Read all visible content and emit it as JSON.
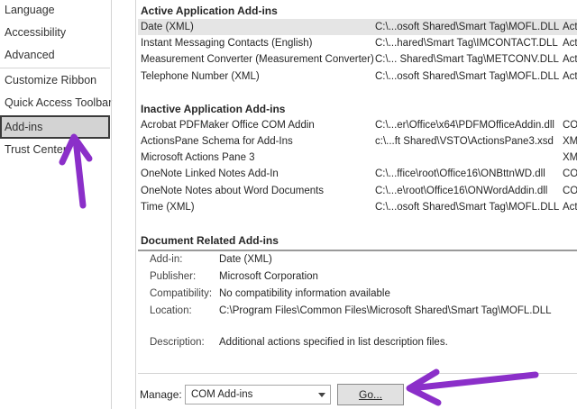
{
  "nav": {
    "items": [
      {
        "label": "Language"
      },
      {
        "label": "Accessibility"
      },
      {
        "label": "Advanced"
      },
      {
        "label": "Customize Ribbon"
      },
      {
        "label": "Quick Access Toolbar"
      },
      {
        "label": "Add-ins",
        "selected": true
      },
      {
        "label": "Trust Center"
      }
    ]
  },
  "addins": {
    "active": {
      "header": "Active Application Add-ins",
      "rows": [
        {
          "name": "Date (XML)",
          "location": "C:\\...osoft Shared\\Smart Tag\\MOFL.DLL",
          "type": "Act"
        },
        {
          "name": "Instant Messaging Contacts (English)",
          "location": "C:\\...hared\\Smart Tag\\IMCONTACT.DLL",
          "type": "Act"
        },
        {
          "name": "Measurement Converter (Measurement Converter)",
          "location": "C:\\... Shared\\Smart Tag\\METCONV.DLL",
          "type": "Act"
        },
        {
          "name": "Telephone Number (XML)",
          "location": "C:\\...osoft Shared\\Smart Tag\\MOFL.DLL",
          "type": "Act"
        }
      ]
    },
    "inactive": {
      "header": "Inactive Application Add-ins",
      "rows": [
        {
          "name": "Acrobat PDFMaker Office COM Addin",
          "location": "C:\\...er\\Office\\x64\\PDFMOfficeAddin.dll",
          "type": "CO"
        },
        {
          "name": "ActionsPane Schema for Add-Ins",
          "location": "c:\\...ft Shared\\VSTO\\ActionsPane3.xsd",
          "type": "XM"
        },
        {
          "name": "Microsoft Actions Pane 3",
          "location": "",
          "type": "XM"
        },
        {
          "name": "OneNote Linked Notes Add-In",
          "location": "C:\\...ffice\\root\\Office16\\ONBttnWD.dll",
          "type": "CO"
        },
        {
          "name": "OneNote Notes about Word Documents",
          "location": "C:\\...e\\root\\Office16\\ONWordAddin.dll",
          "type": "CO"
        },
        {
          "name": "Time (XML)",
          "location": "C:\\...osoft Shared\\Smart Tag\\MOFL.DLL",
          "type": "Act"
        }
      ]
    },
    "document": {
      "header": "Document Related Add-ins"
    }
  },
  "details": {
    "addin_label": "Add-in:",
    "addin_value": "Date (XML)",
    "publisher_label": "Publisher:",
    "publisher_value": "Microsoft Corporation",
    "compat_label": "Compatibility:",
    "compat_value": "No compatibility information available",
    "location_label": "Location:",
    "location_value": "C:\\Program Files\\Common Files\\Microsoft Shared\\Smart Tag\\MOFL.DLL",
    "description_label": "Description:",
    "description_value": "Additional actions specified in list description files."
  },
  "manage": {
    "label": "Manage:",
    "selected": "COM Add-ins",
    "go_label": "Go..."
  },
  "colors": {
    "arrow": "#8b2fc9",
    "selection": "#e5e5e5",
    "nav_selected": "#d3d3d3"
  }
}
